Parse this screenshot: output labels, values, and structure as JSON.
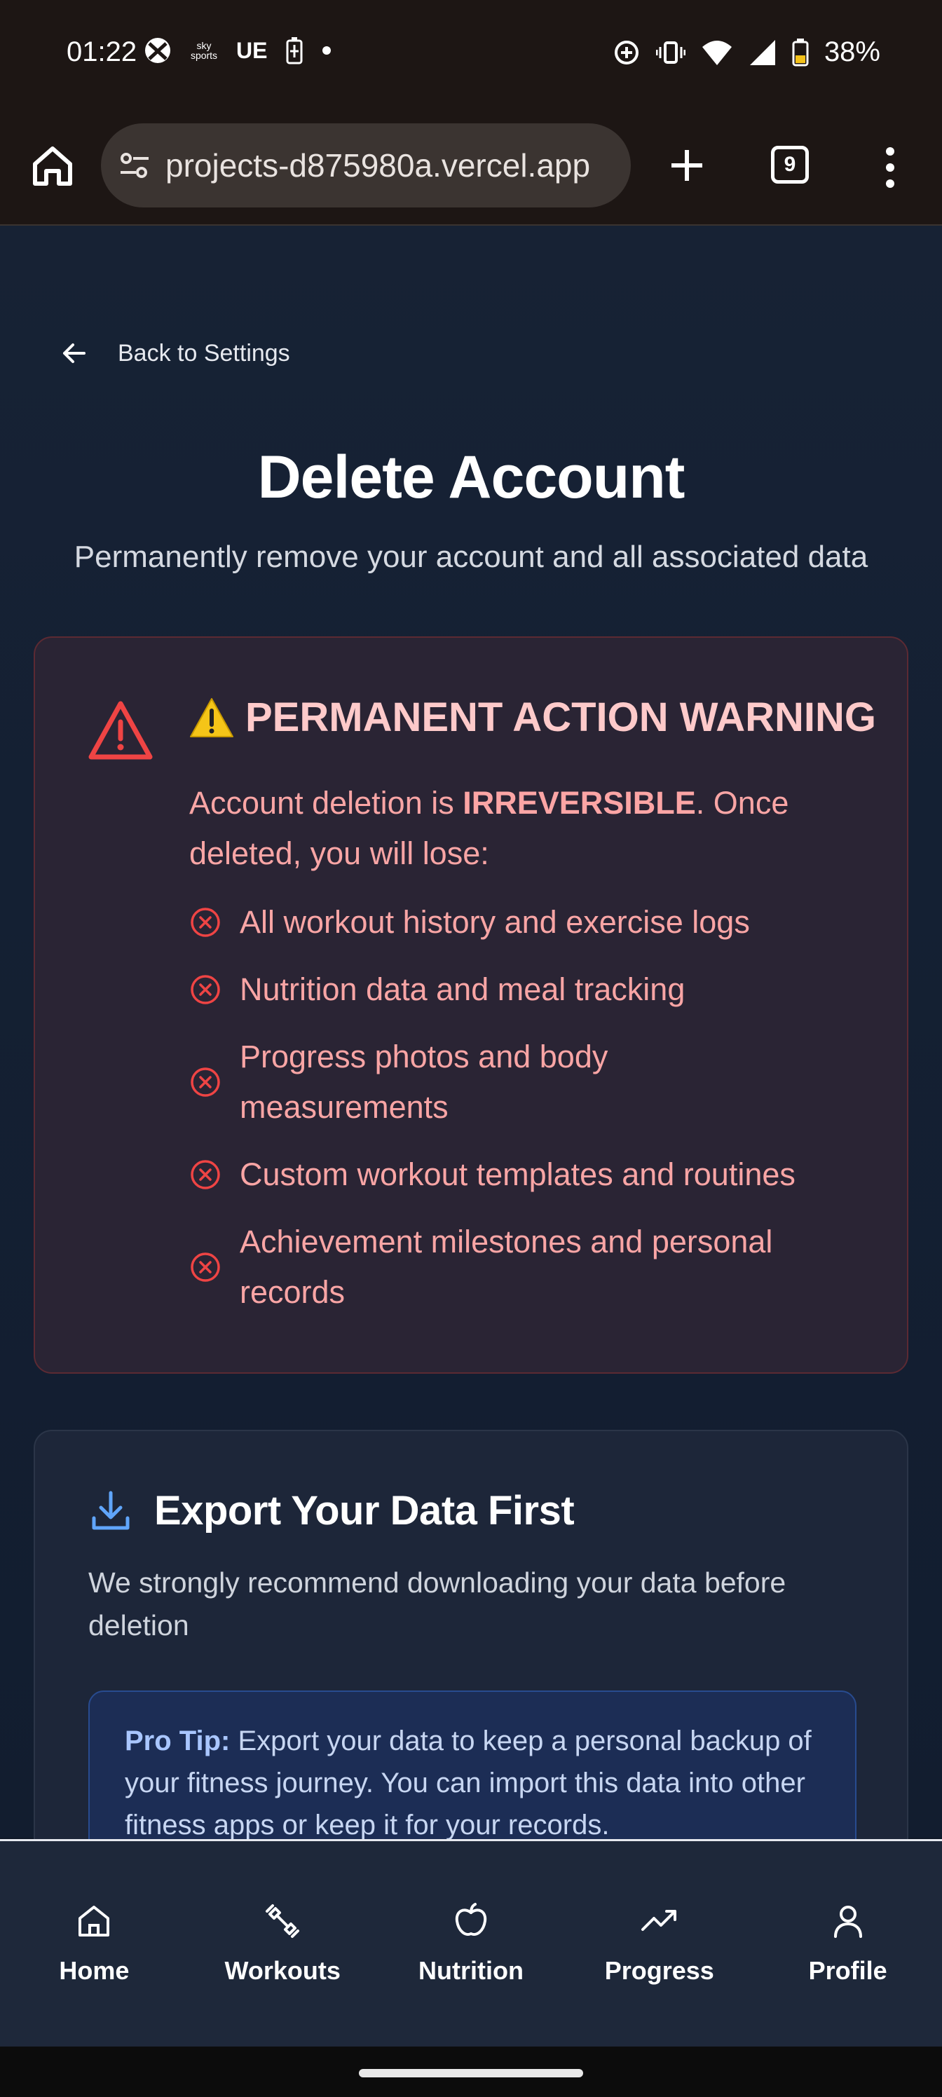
{
  "status_bar": {
    "time": "01:22",
    "left_icons": [
      "xbox-icon",
      "sky-sports-icon",
      "ue-icon",
      "battery-saver-icon",
      "dot-icon"
    ],
    "ue_text": "UE",
    "sky_text": "sky sports",
    "battery_percent": "38%"
  },
  "browser": {
    "url": "projects-d875980a.vercel.app",
    "tab_count": "9"
  },
  "page": {
    "back_label": "Back to Settings",
    "title": "Delete Account",
    "subtitle": "Permanently remove your account and all associated data"
  },
  "warning": {
    "title": "PERMANENT ACTION WARNING",
    "intro_prefix": "Account deletion is ",
    "intro_bold": "IRREVERSIBLE",
    "intro_suffix": ". Once deleted, you will lose:",
    "items": [
      "All workout history and exercise logs",
      "Nutrition data and meal tracking",
      "Progress photos and body measurements",
      "Custom workout templates and routines",
      "Achievement milestones and personal records"
    ],
    "accent_color": "#ef4444"
  },
  "export": {
    "title": "Export Your Data First",
    "description": "We strongly recommend downloading your data before deletion",
    "tip_label": "Pro Tip:",
    "tip_text": " Export your data to keep a personal backup of your fitness journey. You can import this data into other fitness apps or keep it for your records."
  },
  "nav": {
    "items": [
      {
        "label": "Home",
        "icon": "home-icon"
      },
      {
        "label": "Workouts",
        "icon": "dumbbell-icon"
      },
      {
        "label": "Nutrition",
        "icon": "apple-icon"
      },
      {
        "label": "Progress",
        "icon": "trending-up-icon"
      },
      {
        "label": "Profile",
        "icon": "user-icon"
      }
    ]
  }
}
